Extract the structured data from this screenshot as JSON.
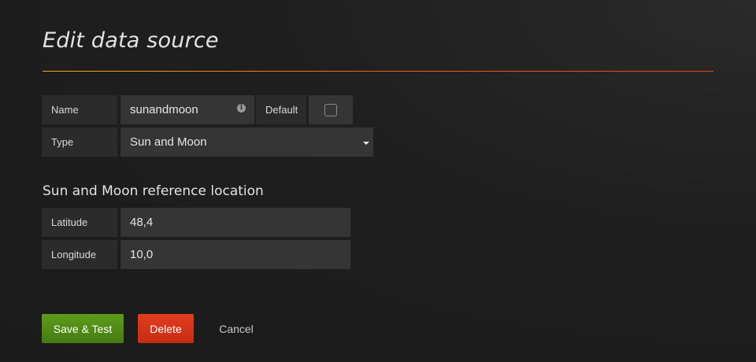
{
  "header": {
    "title": "Edit data source"
  },
  "colors": {
    "background": "#1f1f1f",
    "divider_accent": "#e8601c",
    "save_button": "#53911a",
    "delete_button": "#d63418"
  },
  "form": {
    "name_label": "Name",
    "name_value": "sunandmoon",
    "name_info_icon": "info-icon",
    "default_label": "Default",
    "default_checked": false,
    "type_label": "Type",
    "type_value": "Sun and Moon",
    "type_icon": "caret-down-icon"
  },
  "location": {
    "title": "Sun and Moon reference location",
    "latitude_label": "Latitude",
    "latitude_value": "48,4",
    "longitude_label": "Longitude",
    "longitude_value": "10,0"
  },
  "actions": {
    "save_label": "Save & Test",
    "delete_label": "Delete",
    "cancel_label": "Cancel"
  }
}
